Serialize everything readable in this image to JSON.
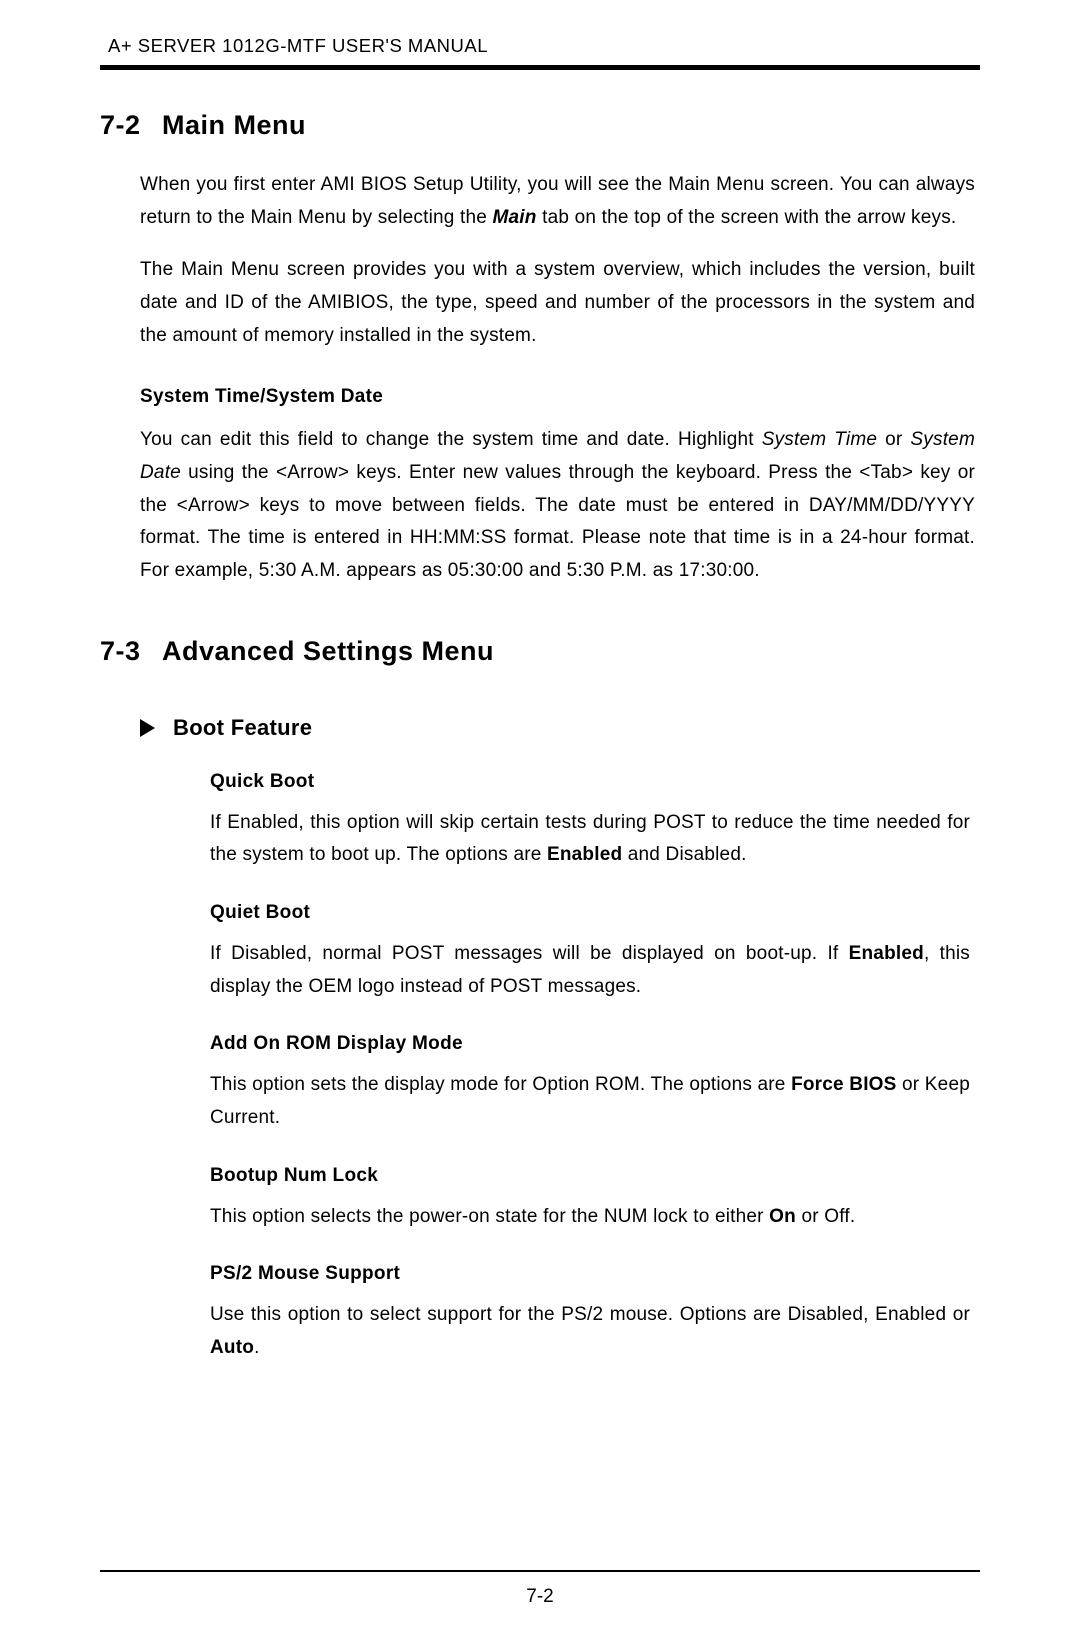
{
  "header": {
    "running_title": "A+ SERVER 1012G-MTF USER'S MANUAL"
  },
  "section_7_2": {
    "num": "7-2",
    "title": "Main Menu",
    "p1_a": "When you first enter AMI BIOS Setup Utility, you will see the Main Menu screen. You can always return to the Main Menu by selecting the ",
    "p1_main": "Main",
    "p1_b": " tab on the top of the screen with the arrow keys.",
    "p2": "The Main Menu screen provides you with a system overview, which includes the version, built date and ID of the AMIBIOS, the type, speed and number of the processors in the system and the amount of memory installed in the system.",
    "sub1": "System Time/System Date",
    "p3_a": "You can edit this field to change the system time and date. Highlight ",
    "p3_st": "System Time",
    "p3_b": " or ",
    "p3_sd": "System Date",
    "p3_c": " using the <Arrow> keys. Enter new values through the keyboard. Press the <Tab> key or the <Arrow> keys to move between fields. The date must be entered in DAY/MM/DD/YYYY format. The time is entered in HH:MM:SS format. Please note that time is in a 24-hour format. For example, 5:30 A.M. appears as 05:30:00 and 5:30 P.M. as 17:30:00."
  },
  "section_7_3": {
    "num": "7-3",
    "title": "Advanced Settings Menu",
    "boot_feature": "Boot Feature",
    "items": {
      "quick_boot": {
        "h": "Quick Boot",
        "t1": "If Enabled, this option will skip certain tests during POST to reduce the time needed for the system to boot up. The options are ",
        "b1": "Enabled",
        "t2": " and Disabled."
      },
      "quiet_boot": {
        "h": "Quiet Boot",
        "t1": "If Disabled, normal POST messages will be displayed on boot-up. If ",
        "b1": "Enabled",
        "t2": ", this display the OEM logo instead of POST messages."
      },
      "addon_rom": {
        "h": "Add On ROM Display Mode",
        "t1": "This option sets the display mode for Option ROM. The options are ",
        "b1": "Force BIOS",
        "t2": " or Keep Current."
      },
      "numlock": {
        "h": "Bootup Num Lock",
        "t1": "This option selects the power-on state for the NUM lock to either ",
        "b1": "On",
        "t2": " or Off."
      },
      "ps2": {
        "h": "PS/2 Mouse Support",
        "t1": "Use this option to select support for the PS/2 mouse. Options are Disabled, Enabled or ",
        "b1": "Auto",
        "t2": "."
      }
    }
  },
  "footer": {
    "page_number": "7-2"
  }
}
